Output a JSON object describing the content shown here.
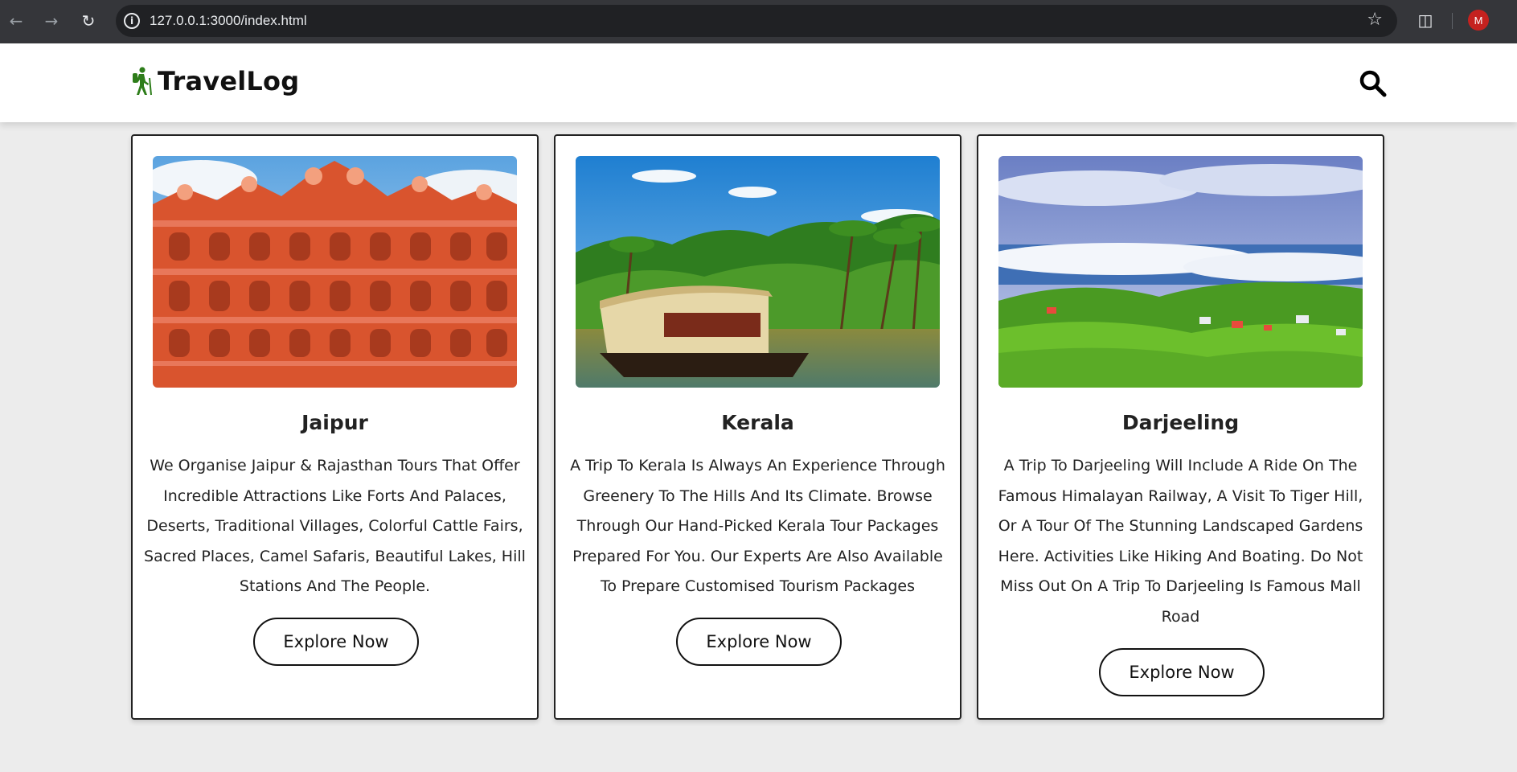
{
  "browser": {
    "url": "127.0.0.1:3000/index.html",
    "profile_initial": "M"
  },
  "site": {
    "brand": "TravelLog",
    "brand_color": "#2e7d1a"
  },
  "cards": [
    {
      "title": "Jaipur",
      "description": "We Organise Jaipur & Rajasthan Tours That Offer Incredible Attractions Like Forts And Palaces, Deserts, Traditional Villages, Colorful Cattle Fairs, Sacred Places, Camel Safaris, Beautiful Lakes, Hill Stations And The People.",
      "button": "Explore Now",
      "image": "hawa-mahal-palace-photo"
    },
    {
      "title": "Kerala",
      "description": "A Trip To Kerala Is Always An Experience Through Greenery To The Hills And Its Climate. Browse Through Our Hand-Picked Kerala Tour Packages Prepared For You. Our Experts Are Also Available To Prepare Customised Tourism Packages",
      "button": "Explore Now",
      "image": "kerala-houseboat-photo"
    },
    {
      "title": "Darjeeling",
      "description": "A Trip To Darjeeling Will Include A Ride On The Famous Himalayan Railway, A Visit To Tiger Hill, Or A Tour Of The Stunning Landscaped Gardens Here. Activities Like Hiking And Boating. Do Not Miss Out On A Trip To Darjeeling Is Famous Mall Road",
      "button": "Explore Now",
      "image": "darjeeling-hills-photo"
    }
  ]
}
